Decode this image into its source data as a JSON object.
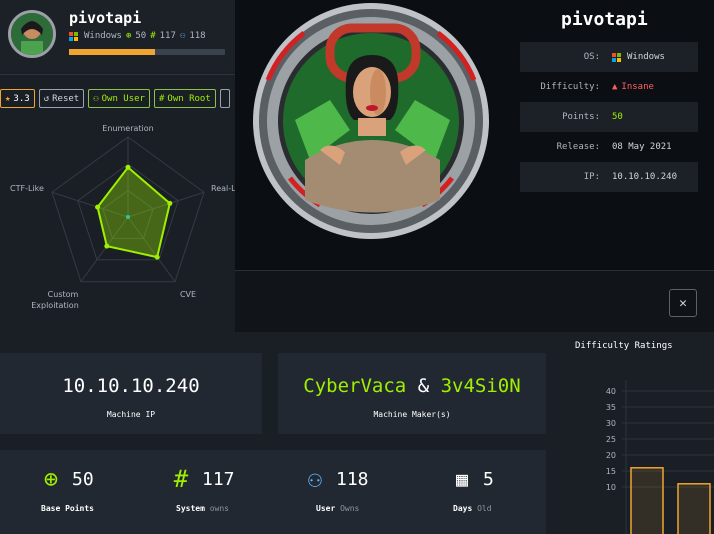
{
  "machine": {
    "name": "pivotapi",
    "os": "Windows",
    "points": "50",
    "user_owns": "117",
    "system_owns_short": "118",
    "progress": 0.55
  },
  "actions": {
    "rating": "3.3",
    "reset": "Reset",
    "own_user": "Own User",
    "own_root": "Own Root"
  },
  "radar": {
    "axes": [
      "Enumeration",
      "Real-Li",
      "CVE",
      "Custom",
      "Exploitation",
      "CTF-Like"
    ],
    "values": [
      0.62,
      0.55,
      0.62,
      0.45,
      0.4
    ]
  },
  "modal": {
    "title": "pivotapi",
    "rows": [
      {
        "label": "OS:",
        "value": "Windows"
      },
      {
        "label": "Difficulty:",
        "value": "Insane"
      },
      {
        "label": "Points:",
        "value": "50"
      },
      {
        "label": "Release:",
        "value": "08 May 2021"
      },
      {
        "label": "IP:",
        "value": "10.10.10.240"
      }
    ],
    "close": "✕"
  },
  "cards": {
    "ip": "10.10.10.240",
    "ip_label": "Machine IP",
    "maker1": "CyberVaca",
    "amp": "&",
    "maker2": "3v4Si0N",
    "maker_label": "Machine Maker(s)"
  },
  "stats": [
    {
      "value": "50",
      "label": "Base Points",
      "sub": ""
    },
    {
      "value": "117",
      "label": "System",
      "sub": "owns"
    },
    {
      "value": "118",
      "label": "User",
      "sub": "Owns"
    },
    {
      "value": "5",
      "label": "Days",
      "sub": "Old"
    }
  ],
  "difficulty": {
    "title": "Difficulty Ratings",
    "yticks": [
      "40",
      "35",
      "30",
      "25",
      "20",
      "15",
      "10"
    ],
    "bars": [
      16,
      11
    ]
  },
  "colors": {
    "accent": "#9fef00",
    "orange": "#f0a52f",
    "danger": "#ff5f5f",
    "blue": "#62b8ff"
  }
}
